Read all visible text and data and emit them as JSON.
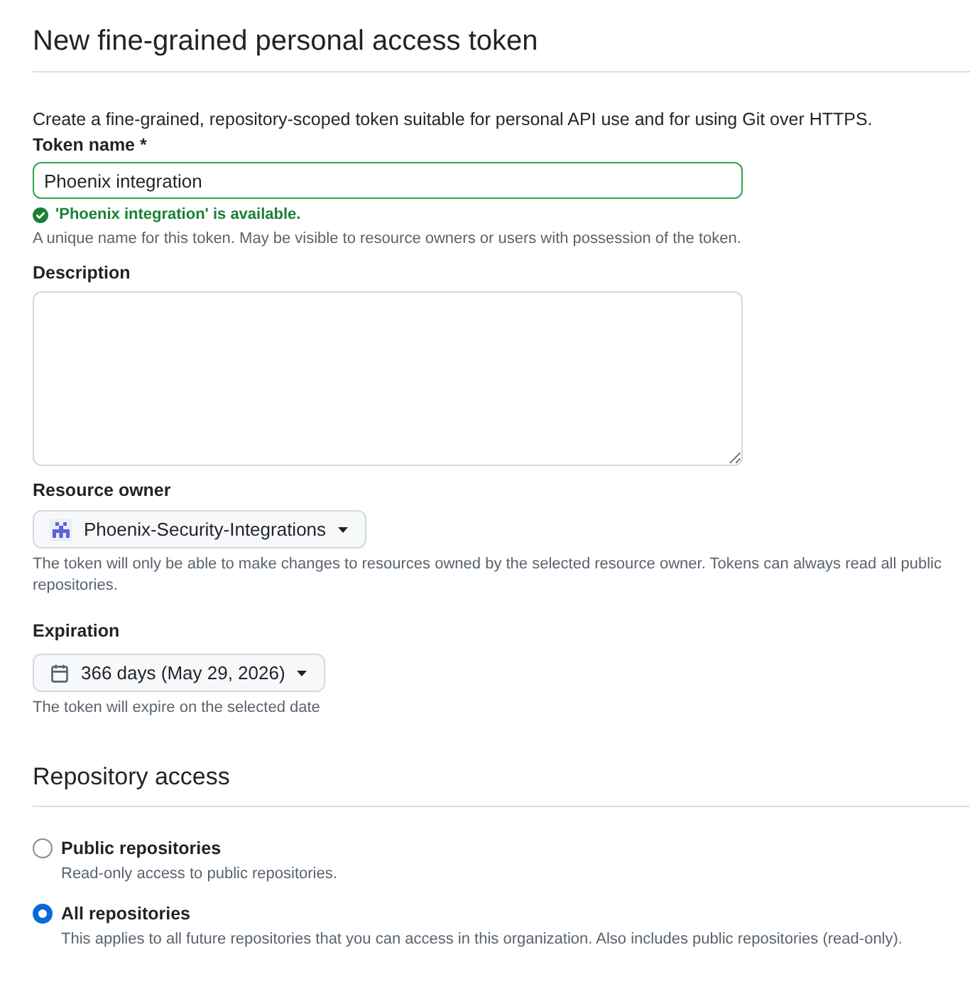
{
  "header": {
    "title": "New fine-grained personal access token"
  },
  "intro": "Create a fine-grained, repository-scoped token suitable for personal API use and for using Git over HTTPS.",
  "fields": [
    {
      "kind": "text_input",
      "label": "Token name *",
      "value": "Phoenix integration",
      "valid": true,
      "validation_message": "'Phoenix integration' is available.",
      "hint": "A unique name for this token. May be visible to resource owners or users with possession of the token."
    },
    {
      "kind": "textarea",
      "label": "Description"
    },
    {
      "kind": "owner_dropdown",
      "label": "Resource owner",
      "value": "Phoenix-Security-Integrations",
      "hint": "The token will only be able to make changes to resources owned by the selected resource owner. Tokens can always read all public repositories."
    },
    {
      "kind": "date_dropdown",
      "label": "Expiration",
      "value": "366 days (May 29, 2026)",
      "hint": "The token will expire on the selected date"
    }
  ],
  "repository_access": {
    "title": "Repository access",
    "options": [
      {
        "label": "Public repositories",
        "description": "Read-only access to public repositories.",
        "selected": false
      },
      {
        "label": "All repositories",
        "description": "This applies to all future repositories that you can access in this organization. Also includes public repositories (read-only).",
        "selected": true
      }
    ]
  }
}
